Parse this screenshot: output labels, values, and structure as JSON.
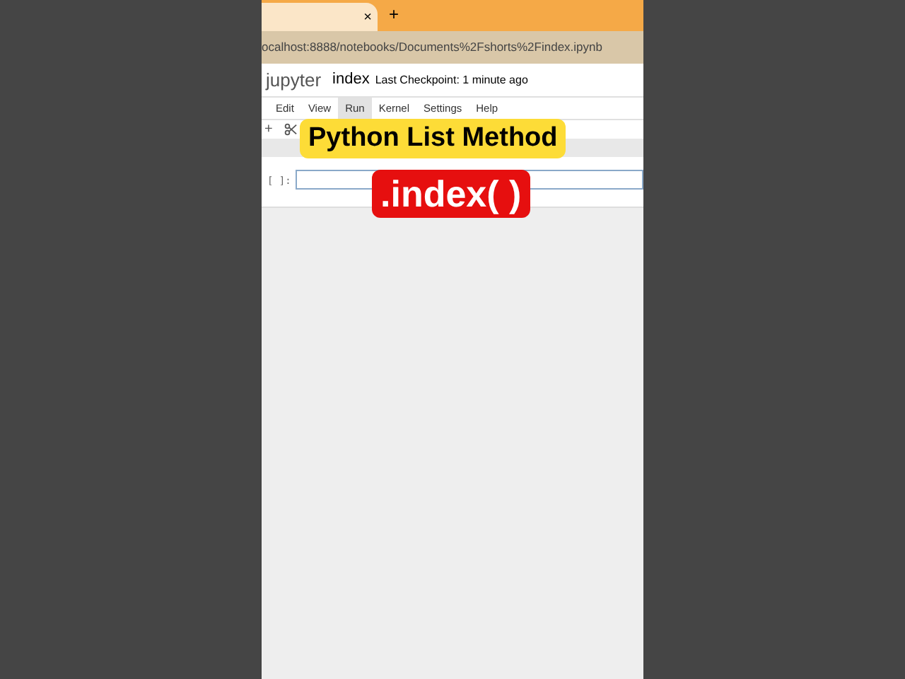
{
  "browser": {
    "tab_close": "×",
    "new_tab": "+",
    "url": "ocalhost:8888/notebooks/Documents%2Fshorts%2Findex.ipynb"
  },
  "notebook": {
    "logo": "jupyter",
    "name": "index",
    "checkpoint": "Last Checkpoint: 1 minute ago"
  },
  "menu": [
    {
      "label": "Edit",
      "selected": false
    },
    {
      "label": "View",
      "selected": false
    },
    {
      "label": "Run",
      "selected": true
    },
    {
      "label": "Kernel",
      "selected": false
    },
    {
      "label": "Settings",
      "selected": false
    },
    {
      "label": "Help",
      "selected": false
    }
  ],
  "toolbar": {
    "add": "+"
  },
  "cell": {
    "prompt": "[ ]:"
  },
  "captions": [
    {
      "text": "Python List Method",
      "kind": "title"
    },
    {
      "text": ".index( )",
      "kind": "code"
    }
  ]
}
